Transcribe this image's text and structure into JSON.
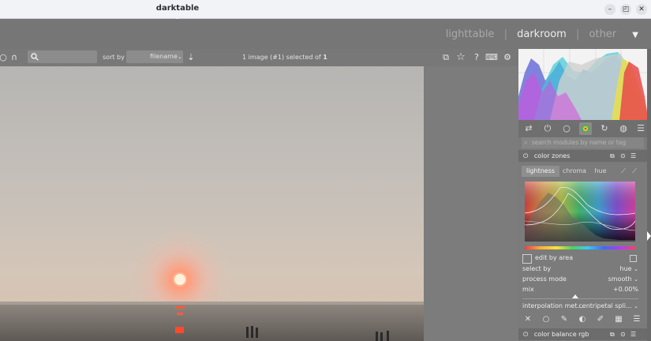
{
  "window": {
    "title": "darktable"
  },
  "views": {
    "lighttable": "lighttable",
    "darkroom": "darkroom",
    "other": "other",
    "separator": "|"
  },
  "toolbar": {
    "sort_by_label": "sort by",
    "sort_value": "filename",
    "selection_prefix": "1 image (#1) selected of",
    "selection_count": "1"
  },
  "panel": {
    "module_search_placeholder": "search modules by name or tag",
    "color_zones": {
      "title": "color zones",
      "tabs": [
        "lightness",
        "chroma",
        "hue"
      ],
      "active_tab": "lightness",
      "edit_by_area_label": "edit by area",
      "select_by_label": "select by",
      "select_by_value": "hue",
      "process_mode_label": "process mode",
      "process_mode_value": "smooth",
      "mix_label": "mix",
      "mix_value": "+0.00%",
      "interpolation_label": "interpolation met...",
      "interpolation_value": "centripetal spli..."
    },
    "next_module_title": "color balance rgb"
  },
  "colors": {
    "titlebar": "#f1f3f6",
    "header": "#767676",
    "panel": "#7b7b7b",
    "histogram_bg": "#f3f3f3"
  },
  "icons": [
    "search-icon",
    "sort-icon",
    "star-icon",
    "help-icon",
    "keyboard-icon",
    "gear-icon",
    "power-icon",
    "chevron-down-icon",
    "presets-icon",
    "menu-icon"
  ]
}
